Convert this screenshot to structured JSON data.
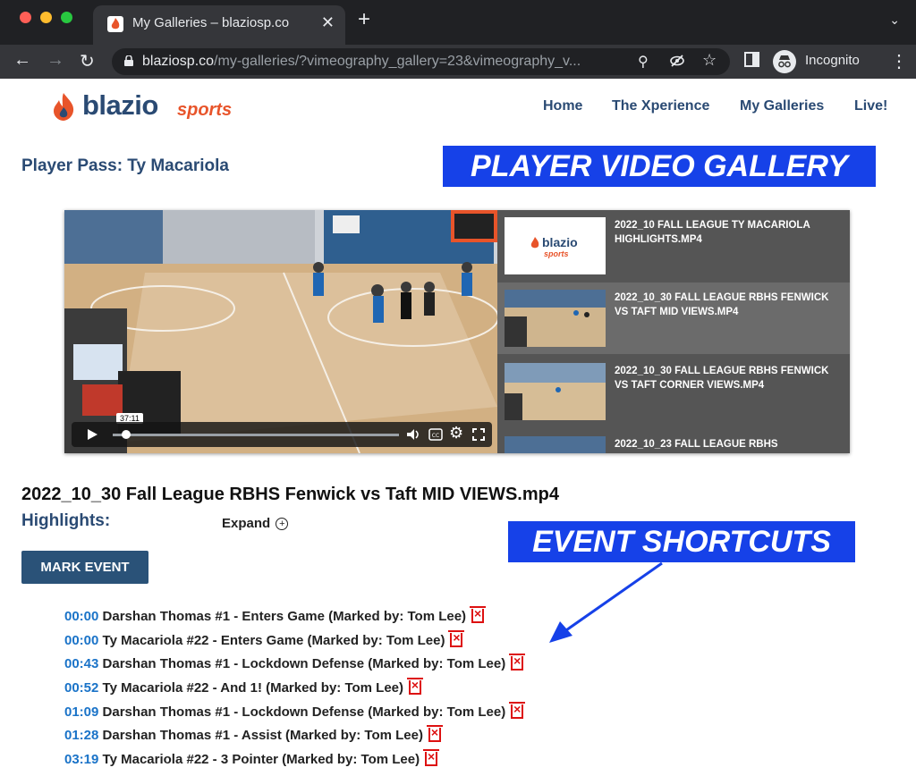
{
  "browser": {
    "tab_title": "My Galleries – blaziosp.co",
    "url_host": "blaziosp.co",
    "url_path": "/my-galleries/?vimeography_gallery=23&vimeography_v...",
    "incognito_label": "Incognito"
  },
  "site": {
    "logo_word": "blazio",
    "logo_sports": "sports",
    "menu": [
      "Home",
      "The Xperience",
      "My Galleries",
      "Live!"
    ],
    "player_pass": "Player Pass: Ty Macariola",
    "brand_color": "#2a4a73",
    "accent_color": "#e8542a"
  },
  "annotations": {
    "gallery_banner": "PLAYER VIDEO GALLERY",
    "shortcuts_banner": "EVENT SHORTCUTS",
    "banner_color": "#1641e8"
  },
  "player": {
    "timecode": "37:11",
    "playlist": [
      {
        "title": "2022_10 FALL LEAGUE TY MACARIOLA HIGHLIGHTS.MP4",
        "thumb": "logo"
      },
      {
        "title": "2022_10_30 FALL LEAGUE RBHS FENWICK VS TAFT MID VIEWS.MP4",
        "thumb": "court",
        "active": true
      },
      {
        "title": "2022_10_30 FALL LEAGUE RBHS FENWICK VS TAFT CORNER VIEWS.MP4",
        "thumb": "court"
      },
      {
        "title": "2022_10_23 FALL LEAGUE RBHS",
        "thumb": "court"
      }
    ],
    "thumb_logo_word": "blazio",
    "thumb_logo_sports": "sports"
  },
  "content": {
    "video_title": "2022_10_30 Fall League RBHS Fenwick vs Taft MID VIEWS.mp4",
    "highlights_label": "Highlights:",
    "expand_label": "Expand",
    "mark_event_label": "MARK EVENT",
    "events": [
      {
        "time": "00:00",
        "text": "Darshan Thomas #1 - Enters Game (Marked by: Tom Lee)"
      },
      {
        "time": "00:00",
        "text": "Ty Macariola #22 - Enters Game (Marked by: Tom Lee)"
      },
      {
        "time": "00:43",
        "text": "Darshan Thomas #1 - Lockdown Defense (Marked by: Tom Lee)"
      },
      {
        "time": "00:52",
        "text": "Ty Macariola #22 - And 1! (Marked by: Tom Lee)"
      },
      {
        "time": "01:09",
        "text": "Darshan Thomas #1 - Lockdown Defense (Marked by: Tom Lee)"
      },
      {
        "time": "01:28",
        "text": "Darshan Thomas #1 - Assist (Marked by: Tom Lee)"
      },
      {
        "time": "03:19",
        "text": "Ty Macariola #22 - 3 Pointer (Marked by: Tom Lee)"
      }
    ]
  }
}
